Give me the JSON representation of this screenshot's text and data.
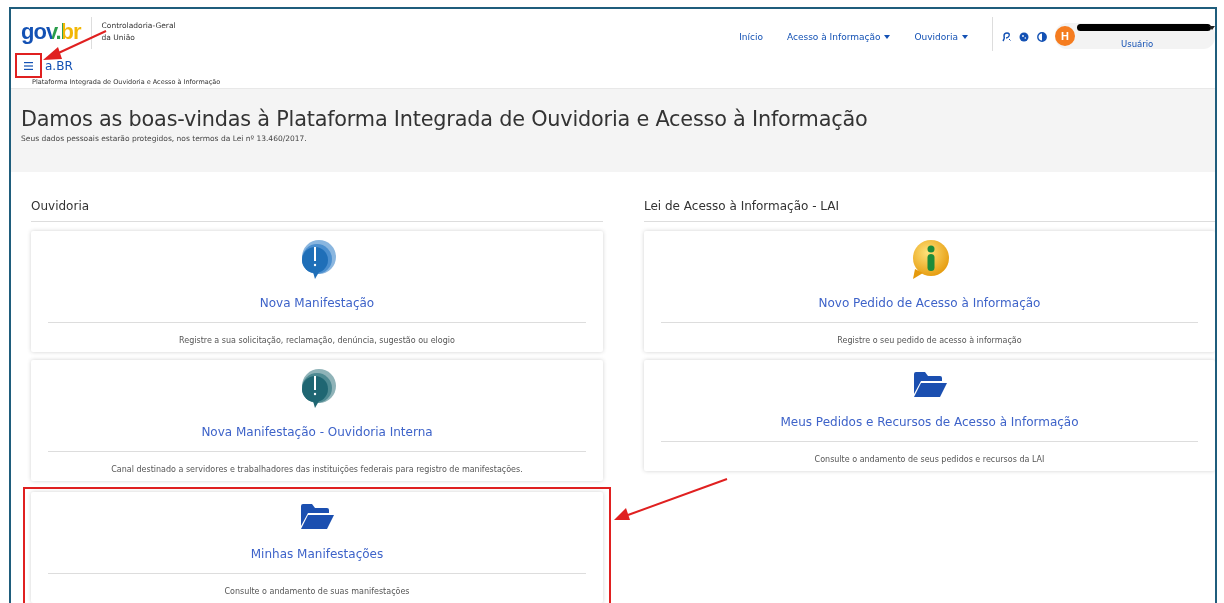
{
  "header": {
    "logo": "gov.br",
    "org_lines": [
      "Controladoria-Geral",
      "da União"
    ],
    "menu_highlighted": true,
    "app_name": "a.BR",
    "app_subtitle": "Plataforma Integrada de Ouvidoria e Acesso à Informação",
    "nav": [
      {
        "label": "Início",
        "dropdown": false
      },
      {
        "label": "Acesso à Informação",
        "dropdown": true
      },
      {
        "label": "Ouvidoria",
        "dropdown": true
      }
    ],
    "user": {
      "avatar": "H",
      "label": "Usuário",
      "name_redacted": true
    }
  },
  "welcome": {
    "title": "Damos as boas-vindas à Plataforma Integrada de Ouvidoria e Acesso à Informação",
    "subtitle": "Seus dados pessoais estarão protegidos, nos termos da Lei nº 13.460/2017."
  },
  "columns": [
    {
      "heading": "Ouvidoria",
      "cards": [
        {
          "kind": "alert-bubble",
          "title": "Nova Manifestação",
          "description": "Registre a sua solicitação, reclamação, denúncia, sugestão ou elogio",
          "highlighted": false
        },
        {
          "kind": "alert-bubble-dark",
          "title": "Nova Manifestação - Ouvidoria Interna",
          "description": "Canal destinado a servidores e trabalhadores das instituições federais para registro de manifestações.",
          "highlighted": false
        },
        {
          "kind": "folder",
          "title": "Minhas Manifestações",
          "description": "Consulte o andamento de suas manifestações",
          "highlighted": true
        }
      ]
    },
    {
      "heading": "Lei de Acesso à Informação - LAI",
      "cards": [
        {
          "kind": "info-bubble",
          "title": "Novo Pedido de Acesso à Informação",
          "description": "Registre o seu pedido de acesso à informação",
          "highlighted": false
        },
        {
          "kind": "folder",
          "title": "Meus Pedidos e Recursos de Acesso à Informação",
          "description": "Consulte o andamento de seus pedidos e recursos da LAI",
          "highlighted": false
        }
      ]
    }
  ]
}
